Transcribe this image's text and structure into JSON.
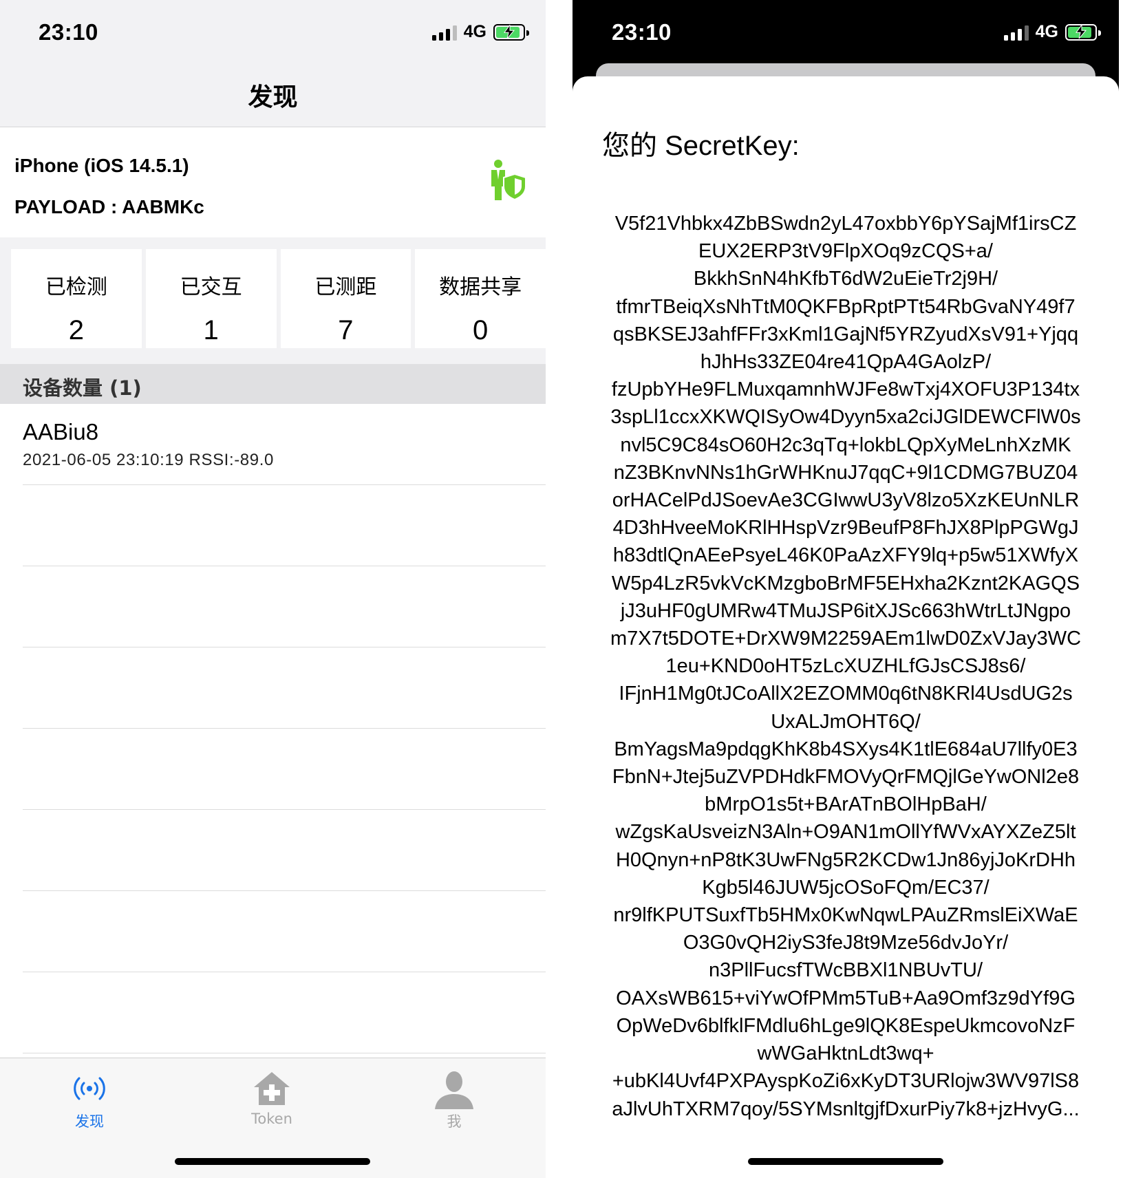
{
  "colors": {
    "accent_blue": "#1a73e8",
    "green": "#6fcf2e",
    "gray_icon": "#a8a8a8",
    "battery_green": "#4cd964"
  },
  "left": {
    "status": {
      "time": "23:10",
      "network": "4G"
    },
    "nav": {
      "title": "发现"
    },
    "device": {
      "name": "iPhone (iOS 14.5.1)",
      "payload": "PAYLOAD : AABMKc",
      "icon": "person-shield-icon"
    },
    "stats": [
      {
        "label": "已检测",
        "value": "2"
      },
      {
        "label": "已交互",
        "value": "1"
      },
      {
        "label": "已测距",
        "value": "7"
      },
      {
        "label": "数据共享",
        "value": "0"
      }
    ],
    "section": {
      "title": "设备数量 (1)"
    },
    "rows": [
      {
        "name": "AABiu8",
        "meta": "2021-06-05 23:10:19 RSSI:-89.0"
      }
    ],
    "tabs": [
      {
        "label": "发现",
        "icon": "broadcast-icon",
        "active": true
      },
      {
        "label": "Token",
        "icon": "medical-house-icon",
        "active": false
      },
      {
        "label": "我",
        "icon": "person-icon",
        "active": false
      }
    ]
  },
  "right": {
    "status": {
      "time": "23:10",
      "network": "4G"
    },
    "sheet": {
      "title": "您的 SecretKey:",
      "key_lines": [
        "V5f21Vhbkx4ZbBSwdn2yL47oxbbY6pYSajMf1irsCZ",
        "EUX2ERP3tV9FlpXOq9zCQS+a/",
        "BkkhSnN4hKfbT6dW2uEieTr2j9H/",
        "tfmrTBeiqXsNhTtM0QKFBpRptPTt54RbGvaNY49f7",
        "qsBKSEJ3ahfFFr3xKml1GajNf5YRZyudXsV91+Yjqq",
        "hJhHs33ZE04re41QpA4GAolzP/",
        "fzUpbYHe9FLMuxqamnhWJFe8wTxj4XOFU3P134tx",
        "3spLl1ccxXKWQISyOw4Dyyn5xa2ciJGlDEWCFlW0s",
        "nvl5C9C84sO60H2c3qTq+lokbLQpXyMeLnhXzMK",
        "nZ3BKnvNNs1hGrWHKnuJ7qqC+9l1CDMG7BUZ04",
        "orHACelPdJSoevAe3CGIwwU3yV8lzo5XzKEUnNLR",
        "4D3hHveeMoKRlHHspVzr9BeufP8FhJX8PlpPGWgJ",
        "h83dtlQnAEePsyeL46K0PaAzXFY9lq+p5w51XWfyX",
        "W5p4LzR5vkVcKMzgboBrMF5EHxha2Kznt2KAGQS",
        "jJ3uHF0gUMRw4TMuJSP6itXJSc663hWtrLtJNgpo",
        "m7X7t5DOTE+DrXW9M2259AEm1lwD0ZxVJay3WC",
        "1eu+KND0oHT5zLcXUZHLfGJsCSJ8s6/",
        "IFjnH1Mg0tJCoAllX2EZOMM0q6tN8KRl4UsdUG2s",
        "UxALJmOHT6Q/",
        "BmYagsMa9pdqgKhK8b4SXys4K1tlE684aU7llfy0E3",
        "FbnN+Jtej5uZVPDHdkFMOVyQrFMQjlGeYwONl2e8",
        "bMrpO1s5t+BArATnBOlHpBaH/",
        "wZgsKaUsveizN3Aln+O9AN1mOllYfWVxAYXZeZ5lt",
        "H0Qnyn+nP8tK3UwFNg5R2KCDw1Jn86yjJoKrDHh",
        "Kgb5l46JUW5jcOSoFQm/EC37/",
        "nr9lfKPUTSuxfTb5HMx0KwNqwLPAuZRmslEiXWaE",
        "O3G0vQH2iyS3feJ8t9Mze56dvJoYr/",
        "n3PllFucsfTWcBBXl1NBUvTU/",
        "OAXsWB615+viYwOfPMm5TuB+Aa9Omf3z9dYf9G",
        "OpWeDv6blfklFMdlu6hLge9lQK8EspeUkmcovoNzF",
        "wWGaHktnLdt3wq+",
        "+ubKl4Uvf4PXPAyspKoZi6xKyDT3URlojw3WV97lS8",
        "aJlvUhTXRM7qoy/5SYMsnltgjfDxurPiy7k8+jzHvyG..."
      ]
    }
  }
}
